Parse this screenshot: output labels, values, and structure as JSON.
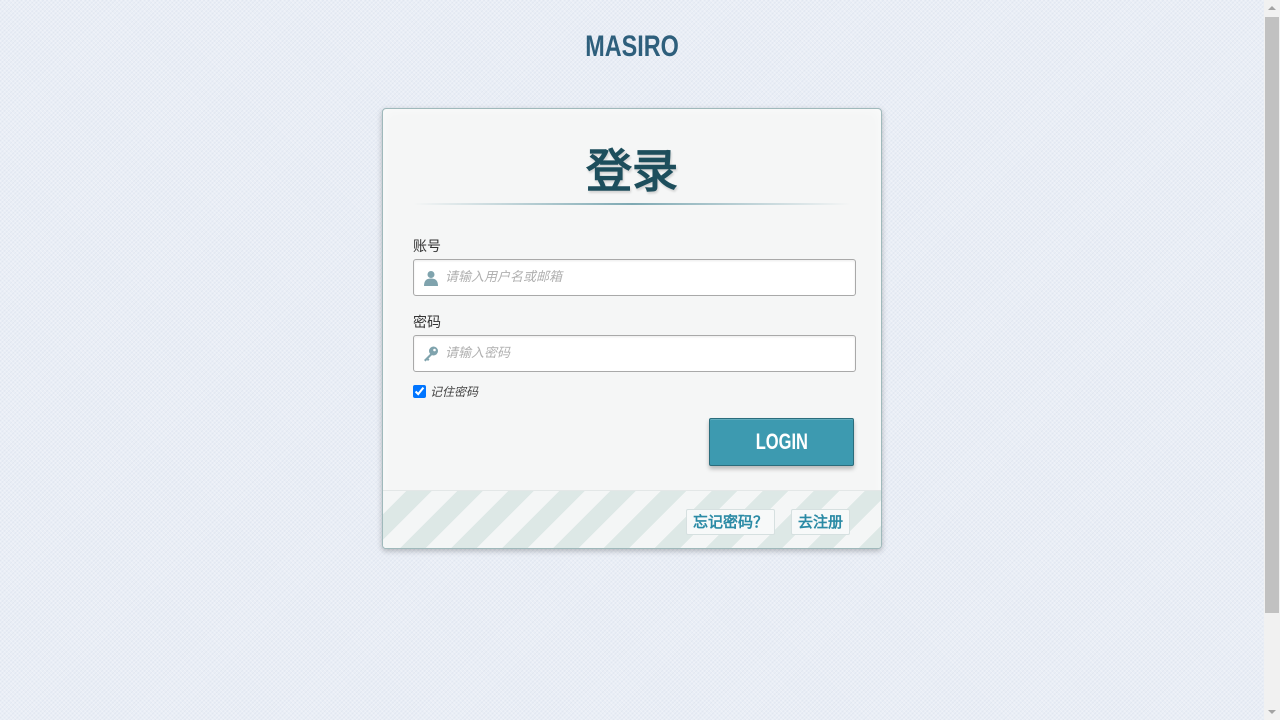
{
  "brand": {
    "name": "MASIRO"
  },
  "login_card": {
    "title": "登录",
    "account": {
      "label": "账号",
      "value": "",
      "placeholder": "请输入用户名或邮箱",
      "icon": "user-icon"
    },
    "password": {
      "label": "密码",
      "value": "",
      "placeholder": "请输入密码",
      "icon": "key-icon"
    },
    "remember": {
      "label": "记住密码",
      "checked": true
    },
    "login_button": "LOGIN",
    "footer": {
      "forgot_link": "忘记密码？",
      "register_link": "去注册"
    }
  },
  "colors": {
    "accent": "#3d9ab0",
    "title": "#1d4e5c",
    "brand": "#2e5f7c",
    "link": "#2a8aa5"
  }
}
